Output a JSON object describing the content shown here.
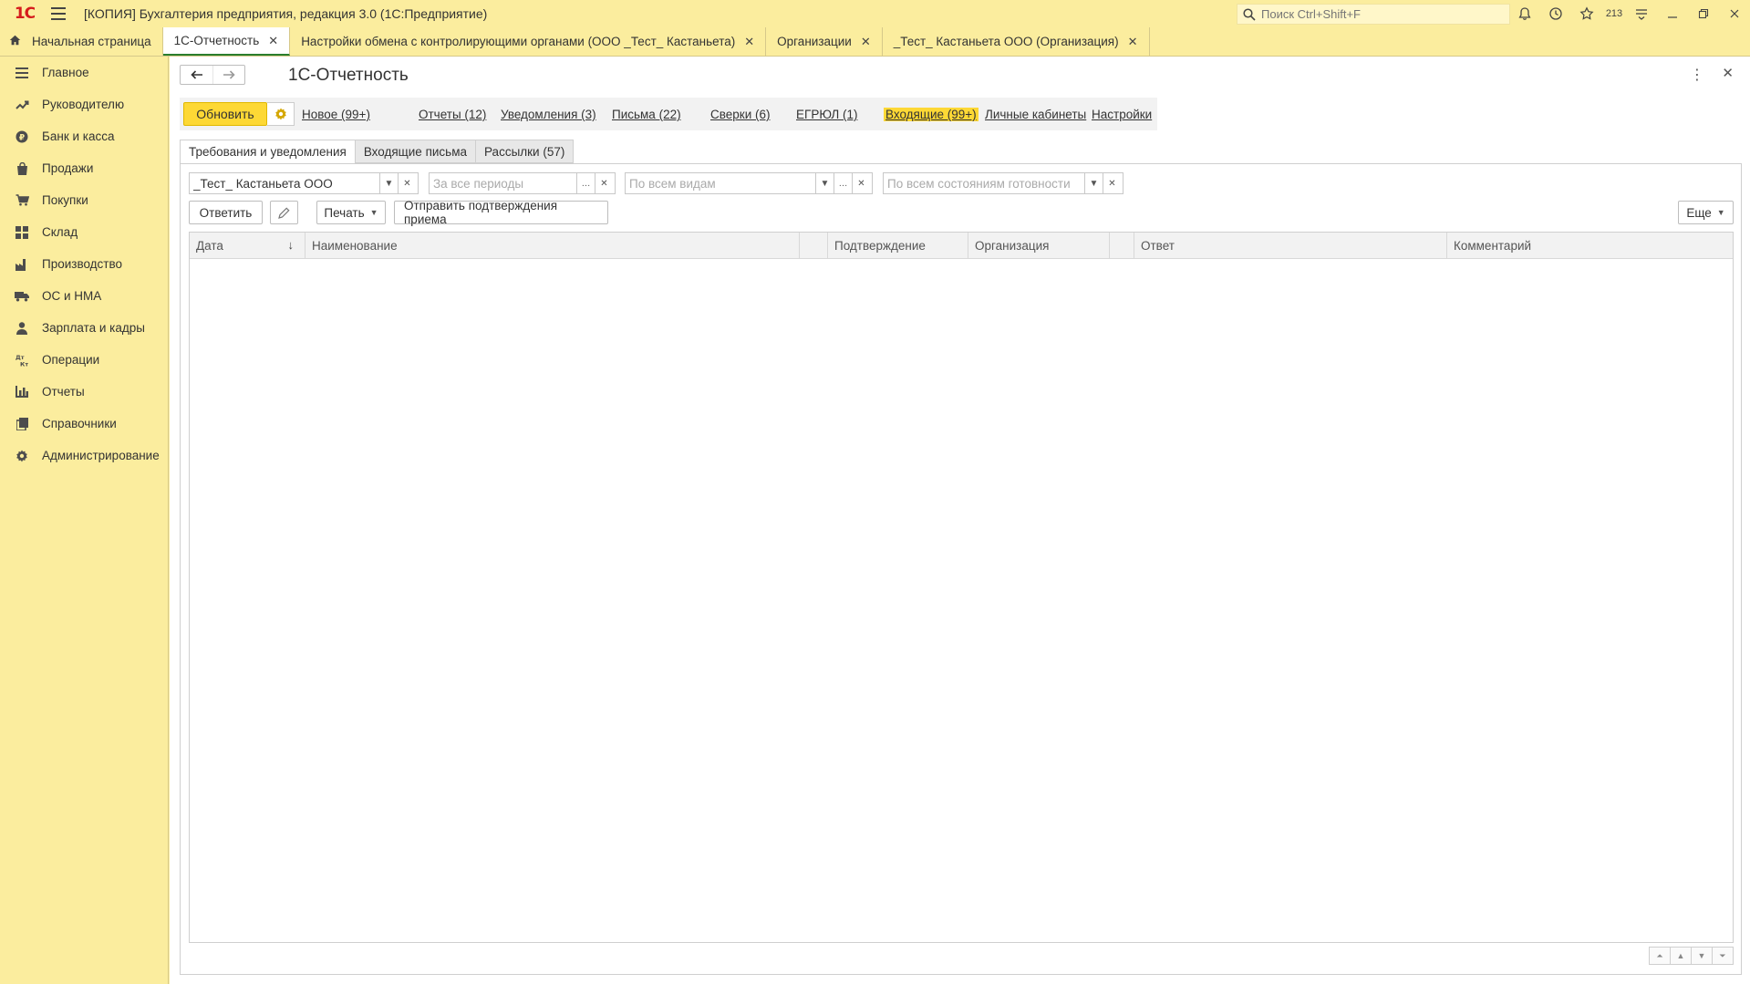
{
  "app": {
    "logo": "1С",
    "title": "[КОПИЯ] Бухгалтерия предприятия, редакция 3.0  (1С:Предприятие)",
    "search_placeholder": "Поиск Ctrl+Shift+F",
    "notification_count": "213"
  },
  "tabs": [
    {
      "label": "Начальная страница"
    },
    {
      "label": "1С-Отчетность"
    },
    {
      "label": "Настройки обмена с контролирующими органами (ООО _Тест_ Кастаньета)"
    },
    {
      "label": "Организации"
    },
    {
      "label": "_Тест_ Кастаньета ООО (Организация)"
    }
  ],
  "sidebar": {
    "items": [
      {
        "label": "Главное",
        "icon": "menu-lines-icon"
      },
      {
        "label": "Руководителю",
        "icon": "trend-icon"
      },
      {
        "label": "Банк и касса",
        "icon": "coin-icon"
      },
      {
        "label": "Продажи",
        "icon": "bag-icon"
      },
      {
        "label": "Покупки",
        "icon": "cart-icon"
      },
      {
        "label": "Склад",
        "icon": "warehouse-icon"
      },
      {
        "label": "Производство",
        "icon": "factory-icon"
      },
      {
        "label": "ОС и НМА",
        "icon": "truck-icon"
      },
      {
        "label": "Зарплата и кадры",
        "icon": "person-icon"
      },
      {
        "label": "Операции",
        "icon": "dt-kt-icon"
      },
      {
        "label": "Отчеты",
        "icon": "bar-chart-icon"
      },
      {
        "label": "Справочники",
        "icon": "books-icon"
      },
      {
        "label": "Администрирование",
        "icon": "gear-icon"
      }
    ]
  },
  "form": {
    "title": "1С-Отчетность",
    "update_button": "Обновить",
    "links": {
      "new": "Новое (99+)",
      "reports": "Отчеты (12)",
      "notifications": "Уведомления (3)",
      "letters": "Письма (22)",
      "reconciliations": "Сверки (6)",
      "egrul": "ЕГРЮЛ (1)",
      "incoming": "Входящие (99+)",
      "cabinets": "Личные кабинеты",
      "settings": "Настройки"
    },
    "subtabs": [
      "Требования и уведомления",
      "Входящие письма",
      "Рассылки (57)"
    ],
    "filters": {
      "organization": "_Тест_ Кастаньета ООО",
      "period_placeholder": "За все периоды",
      "kind_placeholder": "По всем видам",
      "state_placeholder": "По всем состояниям готовности"
    },
    "actions": {
      "reply": "Ответить",
      "print": "Печать",
      "send_confirm": "Отправить подтверждения приема",
      "more": "Еще"
    },
    "columns": [
      "Дата",
      "Наименование",
      "",
      "Подтверждение",
      "Организация",
      "",
      "Ответ",
      "Комментарий"
    ]
  },
  "colors": {
    "background": "#fbed9e",
    "accent_yellow": "#fdd835",
    "active_tab_underline": "#2a7e2e",
    "logo_red": "#d51c1c"
  }
}
